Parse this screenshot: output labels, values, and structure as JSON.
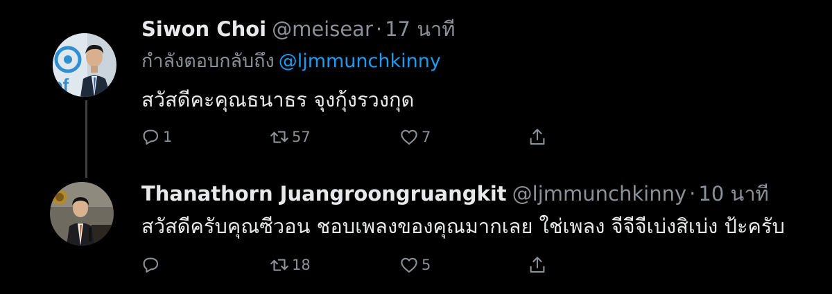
{
  "tweets": [
    {
      "display_name": "Siwon Choi",
      "handle": "@meisear",
      "separator": "·",
      "timestamp": "17 นาที",
      "reply_prefix": "กำลังตอบกลับถึง",
      "reply_mention": "@ljmmunchkinny",
      "text": "สวัสดีคะคุณธนาธร จุงกุ้งรวงกุด",
      "reply_count": "1",
      "retweet_count": "57",
      "like_count": "7"
    },
    {
      "display_name": "Thanathorn Juangroongruangkit",
      "handle": "@ljmmunchkinny",
      "separator": "·",
      "timestamp": "10 นาที",
      "text": "สวัสดีครับคุณซีวอน ชอบเพลงของคุณมากเลย ใช่เพลง จีจีจีเบ่งสิเบ่ง ป้ะครับ",
      "reply_count": "",
      "retweet_count": "18",
      "like_count": "5"
    }
  ],
  "icons": {
    "reply": "reply-icon",
    "retweet": "retweet-icon",
    "like": "heart-icon",
    "share": "share-icon"
  },
  "colors": {
    "background": "#000000",
    "text": "#e7e9ea",
    "muted": "#8b9198",
    "link": "#1d9bf0",
    "thread_line": "#3d4146"
  }
}
